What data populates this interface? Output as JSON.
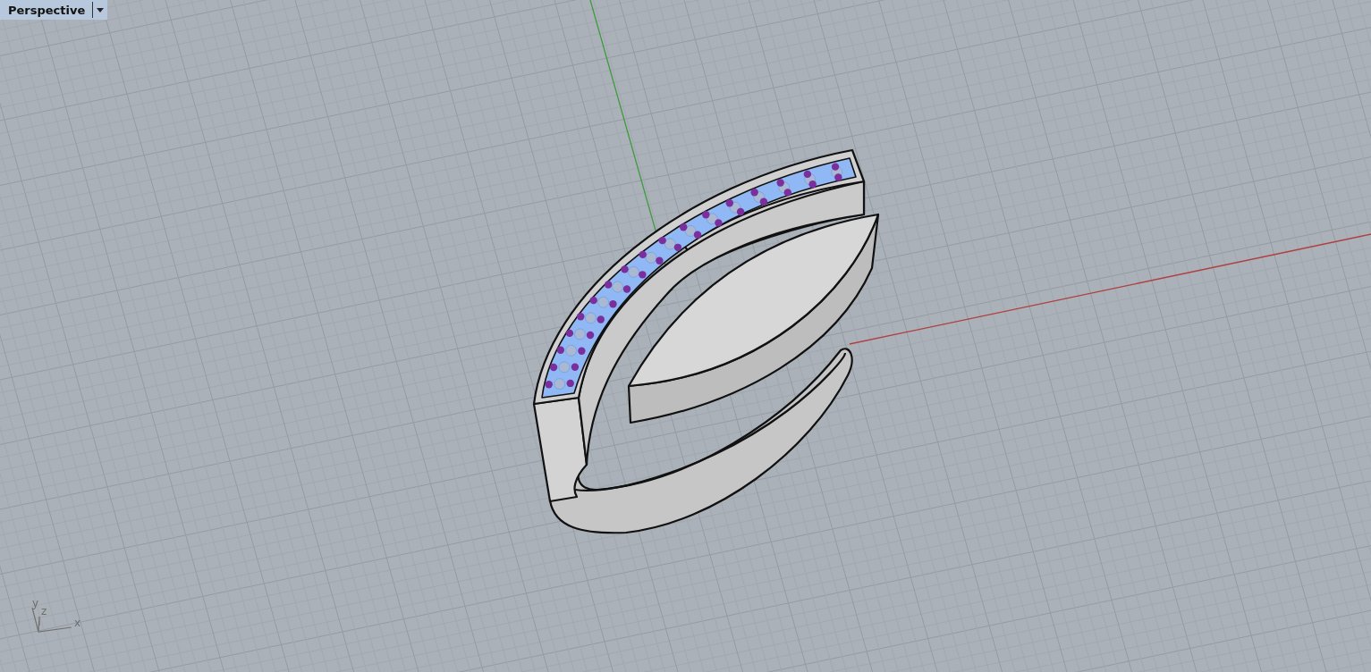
{
  "viewport": {
    "title": "Perspective",
    "axis_labels": [
      "y",
      "z",
      "x"
    ]
  }
}
